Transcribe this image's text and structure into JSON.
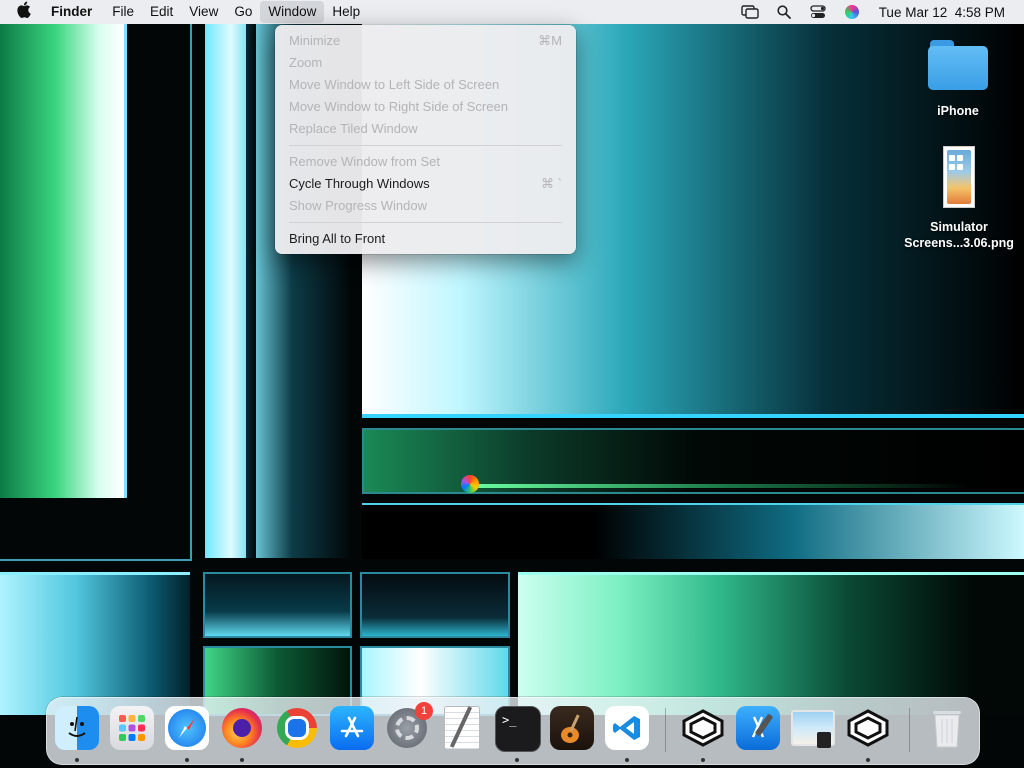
{
  "menubar": {
    "apple_icon": "apple-logo-icon",
    "app_name": "Finder",
    "items": [
      "File",
      "Edit",
      "View",
      "Go",
      "Window",
      "Help"
    ],
    "active_item": "Window",
    "status_icons": [
      "screen-mirroring-icon",
      "spotlight-search-icon",
      "control-center-icon",
      "siri-icon"
    ],
    "clock": "Tue Mar 12  4:58 PM"
  },
  "window_menu": {
    "items": [
      {
        "label": "Minimize",
        "shortcut": "⌘M",
        "enabled": false
      },
      {
        "label": "Zoom",
        "shortcut": "",
        "enabled": false
      },
      {
        "label": "Move Window to Left Side of Screen",
        "shortcut": "",
        "enabled": false
      },
      {
        "label": "Move Window to Right Side of Screen",
        "shortcut": "",
        "enabled": false
      },
      {
        "label": "Replace Tiled Window",
        "shortcut": "",
        "enabled": false
      },
      {
        "label": "Remove Window from Set",
        "shortcut": "",
        "enabled": false
      },
      {
        "label": "Cycle Through Windows",
        "shortcut": "⌘ `",
        "enabled": true
      },
      {
        "label": "Show Progress Window",
        "shortcut": "",
        "enabled": false
      },
      {
        "label": "Bring All to Front",
        "shortcut": "",
        "enabled": true
      }
    ]
  },
  "desktop": {
    "icons": [
      {
        "label_line1": "iPhone",
        "label_line2": "",
        "icon": "folder-icon"
      },
      {
        "label_line1": "Simulator",
        "label_line2": "Screens...3.06.png",
        "icon": "image-file-icon"
      }
    ]
  },
  "dock": {
    "apps": [
      {
        "name": "Finder",
        "icon": "finder-icon",
        "running": true
      },
      {
        "name": "Launchpad",
        "icon": "launchpad-icon",
        "running": false
      },
      {
        "name": "Safari",
        "icon": "safari-icon",
        "running": true
      },
      {
        "name": "Firefox",
        "icon": "firefox-icon",
        "running": true
      },
      {
        "name": "Chrome",
        "icon": "chrome-icon",
        "running": false
      },
      {
        "name": "App Store",
        "icon": "app-store-icon",
        "running": false
      },
      {
        "name": "System Settings",
        "icon": "system-settings-icon",
        "running": false,
        "badge": "1"
      },
      {
        "name": "TextEdit",
        "icon": "textedit-icon",
        "running": false
      },
      {
        "name": "Terminal",
        "icon": "terminal-icon",
        "running": true
      },
      {
        "name": "GarageBand",
        "icon": "garageband-icon",
        "running": false
      },
      {
        "name": "Visual Studio Code",
        "icon": "vscode-icon",
        "running": true
      },
      {
        "name": "App 1",
        "icon": "hexagon-app-icon",
        "running": true
      },
      {
        "name": "Xcode",
        "icon": "xcode-icon",
        "running": false
      },
      {
        "name": "Preview",
        "icon": "preview-icon",
        "running": false
      },
      {
        "name": "App 2",
        "icon": "hexagon-app-icon",
        "running": true
      },
      {
        "name": "Trash",
        "icon": "trash-icon",
        "running": false
      }
    ]
  },
  "colors": {
    "accent_cyan": "#66e0f0",
    "accent_green": "#3fe08a",
    "menubar_bg": "#ebedf0",
    "badge_red": "#f2403a"
  }
}
